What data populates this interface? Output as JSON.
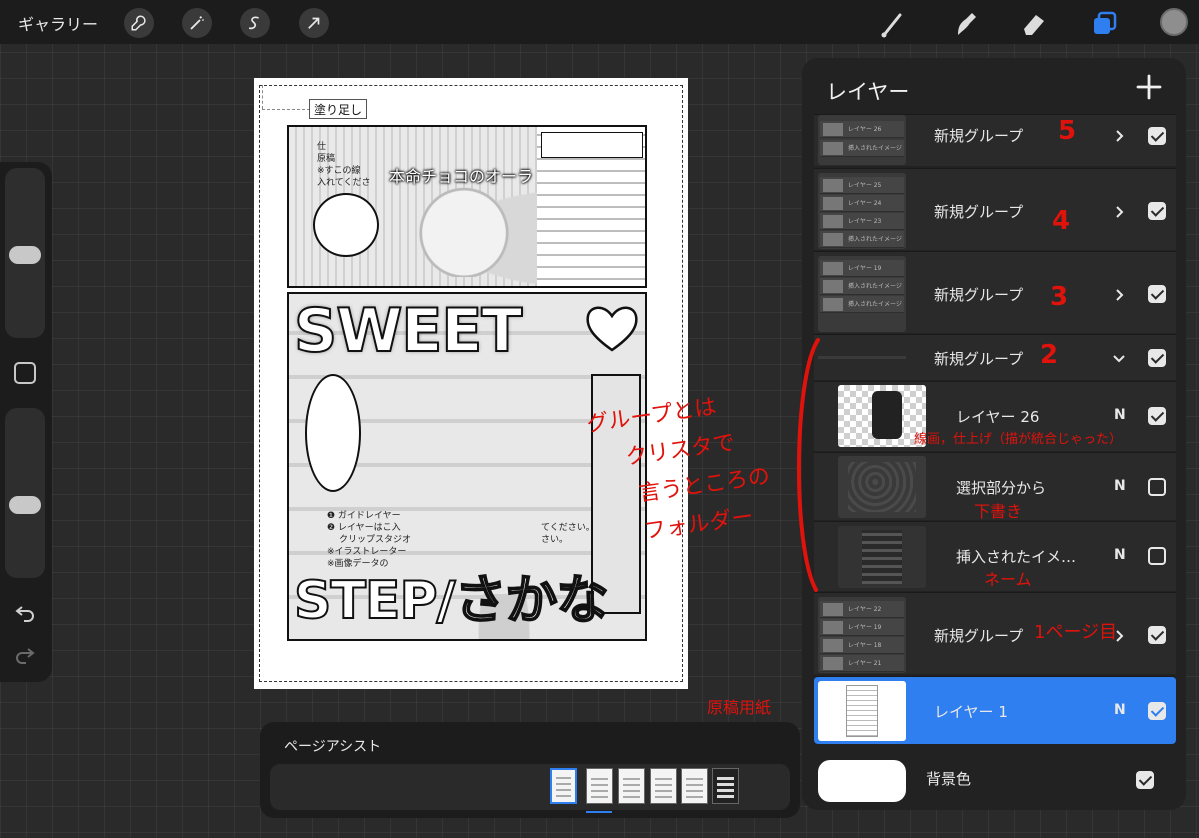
{
  "toolbar": {
    "gallery_label": "ギャラリー",
    "left_tools": [
      "wrench-icon",
      "magic-wand-icon",
      "selection-icon",
      "transform-arrow-icon"
    ],
    "right_tools": [
      "brush-icon",
      "smudge-icon",
      "eraser-icon",
      "layers-icon"
    ],
    "active_color": "#8e8e8e",
    "accent": "#2f7ff0"
  },
  "canvas": {
    "bleed_label": "塗り足し",
    "panel1_title": "本命チョコのオーラ",
    "guide_top_lines": [
      "仕",
      "原稿",
      "※すこの線",
      "入れてくださ"
    ],
    "guide_bottom_lines": [
      "❶ ガイドレイヤー",
      "❷ レイヤーはこ入",
      "クリップスタジオ",
      "※イラストレーター",
      "※画像データの"
    ],
    "guide_right_lines": [
      "てください。",
      "さい。"
    ],
    "sweet_text": "SWEET",
    "step_text": "STEP/さかな"
  },
  "annotations": {
    "group_note": [
      "グループとは",
      "クリスタで",
      "言うところの",
      "フォルダー"
    ],
    "num_5": "5",
    "num_4": "4",
    "num_3": "3",
    "num_2": "2",
    "page1_label": "1ページ目",
    "lineart_note": "線画，仕上げ（描が統合じゃった）",
    "draft_note": "下書き",
    "name_note": "ネーム",
    "manuscript_note": "原稿用紙"
  },
  "page_assist": {
    "title": "ページアシスト",
    "page_count": 6,
    "selected_index": 0
  },
  "layers": {
    "title": "レイヤー",
    "mini_labels": [
      "レイヤー 26",
      "挿入されたイメージ",
      "レイヤー 25",
      "レイヤー 24",
      "レイヤー 23",
      "レイヤー 19",
      "レイヤー 22",
      "レイヤー 18",
      "レイヤー 21"
    ],
    "rows": [
      {
        "name": "新規グループ",
        "blend": "",
        "visible": true
      },
      {
        "name": "新規グループ",
        "blend": "",
        "visible": true
      },
      {
        "name": "新規グループ",
        "blend": "",
        "visible": true
      },
      {
        "name": "新規グループ",
        "blend": "",
        "visible": true
      },
      {
        "name": "レイヤー 26",
        "blend": "N",
        "visible": true
      },
      {
        "name": "選択部分から",
        "blend": "N",
        "visible": false
      },
      {
        "name": "挿入されたイメ…",
        "blend": "N",
        "visible": false
      },
      {
        "name": "新規グループ",
        "blend": "",
        "visible": true
      },
      {
        "name": "レイヤー 1",
        "blend": "N",
        "visible": true
      }
    ],
    "background_label": "背景色",
    "background_color": "#ffffff",
    "background_visible": true
  }
}
